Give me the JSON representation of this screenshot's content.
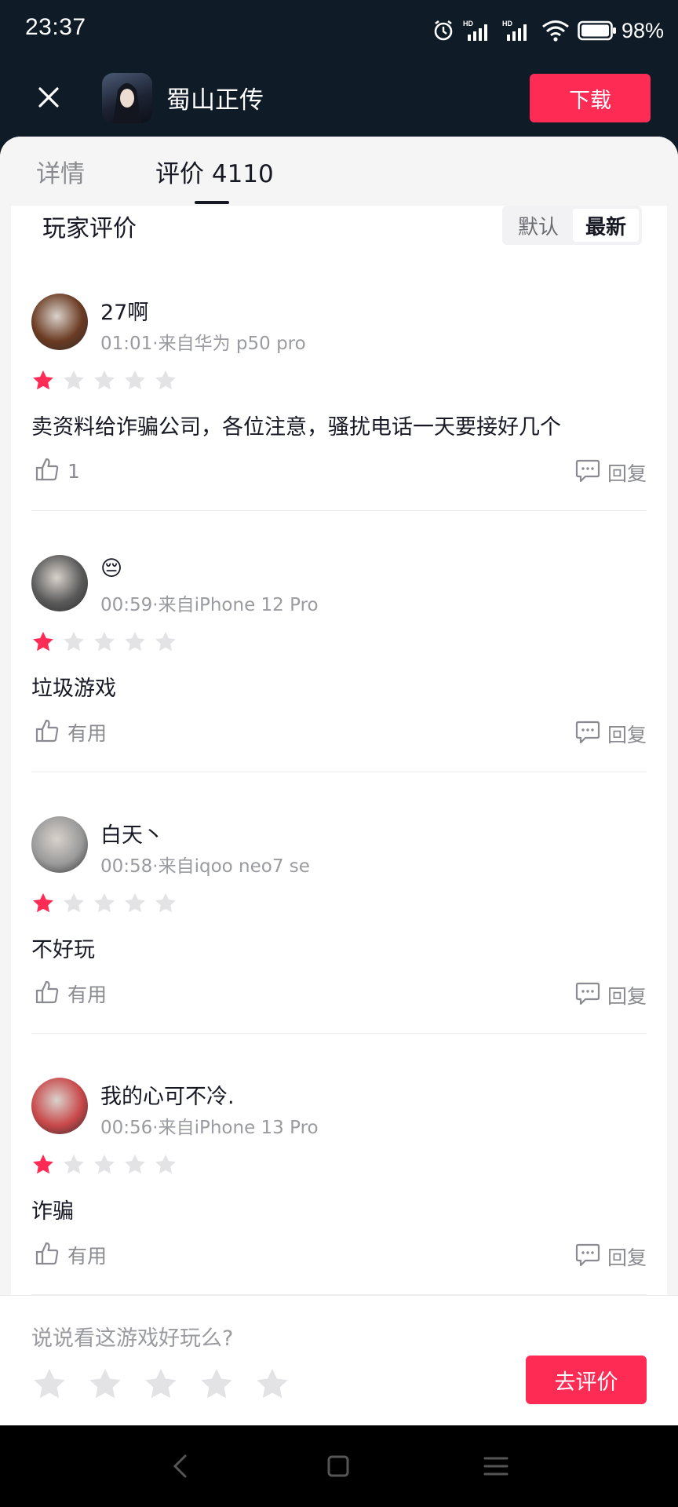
{
  "status_bar": {
    "time": "23:37",
    "battery": "98%",
    "icons": [
      "alarm-icon",
      "hd-signal-icon",
      "hd-signal-icon",
      "wifi-icon",
      "battery-icon"
    ]
  },
  "header": {
    "game_title": "蜀山正传",
    "download_label": "下载",
    "close_icon": "close-icon"
  },
  "tabs": [
    {
      "label": "详情",
      "active": false
    },
    {
      "label": "评价 4110",
      "active": true
    }
  ],
  "reviews_section": {
    "title": "玩家评价",
    "sort_options": [
      "默认",
      "最新"
    ],
    "selected_sort": "最新"
  },
  "reviews": [
    {
      "username": "27啊",
      "meta": "01:01·来自华为 p50 pro",
      "rating": 1,
      "content": "卖资料给诈骗公司，各位注意，骚扰电话一天要接好几个",
      "like_label": "1",
      "reply_label": "回复",
      "avatar_color": "#6b3b22"
    },
    {
      "username": "😔",
      "meta": "00:59·来自iPhone 12 Pro",
      "rating": 1,
      "content": "垃圾游戏",
      "like_label": "有用",
      "reply_label": "回复",
      "avatar_color": "#5a5a5a"
    },
    {
      "username": "白天丶",
      "meta": "00:58·来自iqoo neo7 se",
      "rating": 1,
      "content": "不好玩",
      "like_label": "有用",
      "reply_label": "回复",
      "avatar_color": "#9a9a9a"
    },
    {
      "username": "我的心可不冷.",
      "meta": "00:56·来自iPhone 13 Pro",
      "rating": 1,
      "content": "诈骗",
      "like_label": "有用",
      "reply_label": "回复",
      "avatar_color": "#c9484a"
    }
  ],
  "rate_bar": {
    "prompt": "说说看这游戏好玩么?",
    "star_count": 5,
    "button_label": "去评价"
  },
  "colors": {
    "accent": "#fe2c55",
    "header_bg": "#0f1b27",
    "star_inactive": "#e3e3e6"
  }
}
